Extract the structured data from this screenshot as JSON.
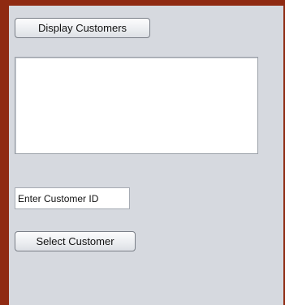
{
  "window": {
    "frame_color": "#8f2a12",
    "panel_color": "#d6d9df"
  },
  "controls": {
    "display_button_label": "Display Customers",
    "customer_id_value": "Enter Customer ID",
    "select_button_label": "Select Customer"
  }
}
